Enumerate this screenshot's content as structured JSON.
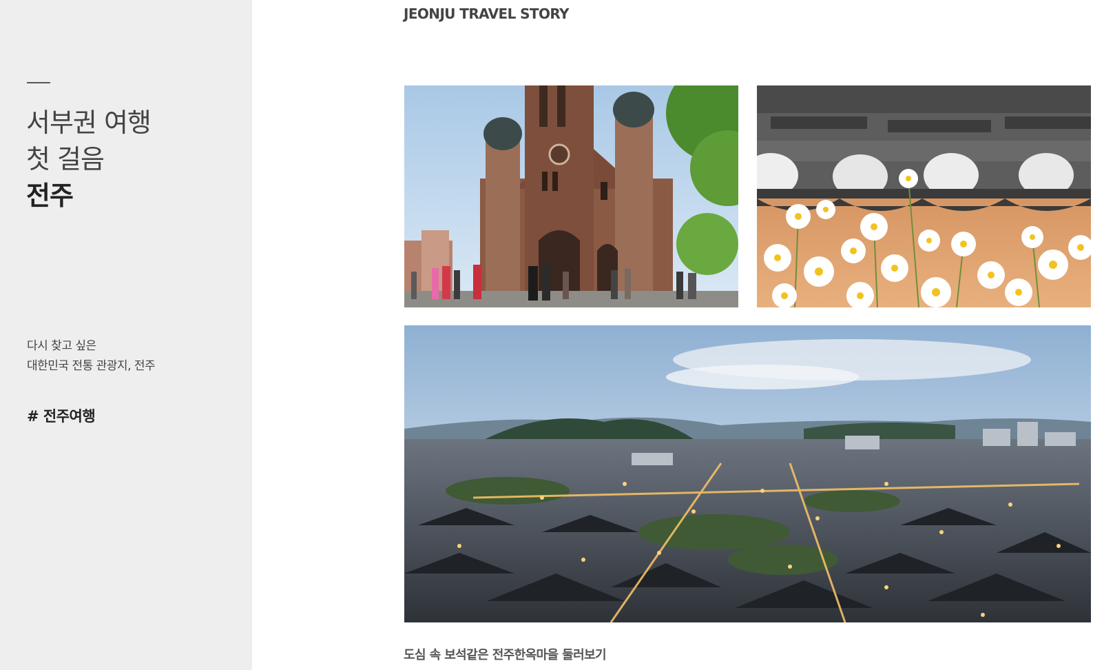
{
  "sidebar": {
    "headline": {
      "line1": "서부권 여행",
      "line2": "첫 걸음",
      "line3": "전주"
    },
    "description": {
      "line1": "다시 찾고 싶은",
      "line2": "대한민국 전통 관광지, 전주"
    },
    "hashtag": "# 전주여행"
  },
  "main": {
    "section_label": "JEONJU TRAVEL STORY",
    "photos": [
      {
        "subject": "cathedral-photo"
      },
      {
        "subject": "daisy-flowers-roof-tiles-photo"
      },
      {
        "subject": "hanok-village-panorama-photo"
      }
    ],
    "caption": "도심 속 보석같은 전주한옥마을 둘러보기"
  },
  "colors": {
    "sidebar_bg": "#eeeeee",
    "text_dark": "#222222",
    "text_mid": "#444444"
  }
}
